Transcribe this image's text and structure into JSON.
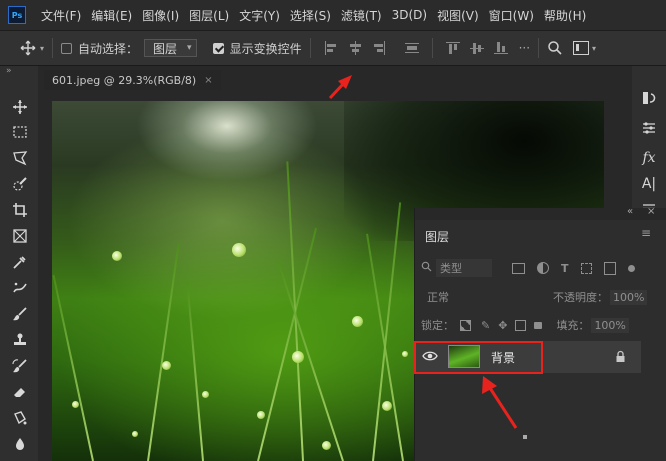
{
  "menubar": {
    "logo": "Ps",
    "items": [
      "文件(F)",
      "编辑(E)",
      "图像(I)",
      "图层(L)",
      "文字(Y)",
      "选择(S)",
      "滤镜(T)",
      "3D(D)",
      "视图(V)",
      "窗口(W)",
      "帮助(H)"
    ]
  },
  "options": {
    "auto_select_label": "自动选择：",
    "auto_select_value": "图层",
    "show_transform_label": "显示变换控件"
  },
  "document": {
    "tab_title": "601.jpeg @ 29.3%(RGB/8)",
    "tab_close": "×"
  },
  "right_strip": {
    "fx_label": "fx",
    "char_label": "A|"
  },
  "layers_panel": {
    "title": "图层",
    "filter_placeholder": "类型",
    "blend_mode": "正常",
    "opacity_label": "不透明度：",
    "opacity_value": "100%",
    "lock_label": "锁定：",
    "fill_label": "填充：",
    "fill_value": "100%",
    "layer_name": "背景",
    "collapse_glyph": "«",
    "close_glyph": "×"
  },
  "annotation_color": "#e8231e"
}
